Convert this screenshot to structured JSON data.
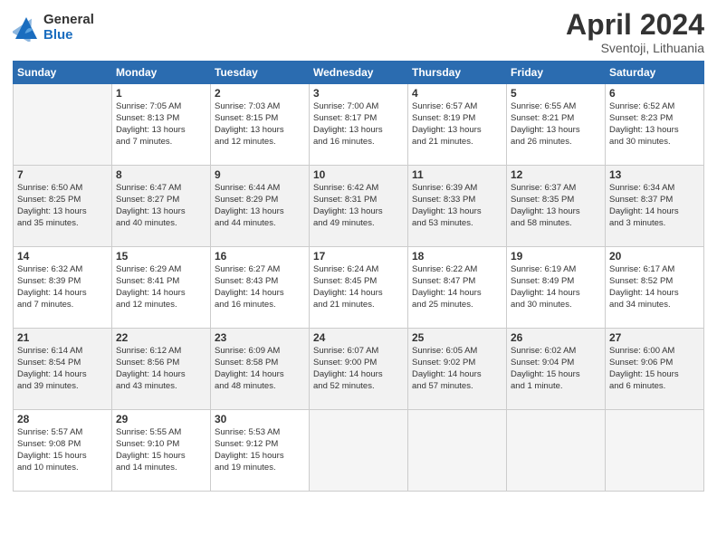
{
  "logo": {
    "general": "General",
    "blue": "Blue"
  },
  "title": "April 2024",
  "location": "Sventoji, Lithuania",
  "days_of_week": [
    "Sunday",
    "Monday",
    "Tuesday",
    "Wednesday",
    "Thursday",
    "Friday",
    "Saturday"
  ],
  "weeks": [
    [
      {
        "day": "",
        "info": ""
      },
      {
        "day": "1",
        "info": "Sunrise: 7:05 AM\nSunset: 8:13 PM\nDaylight: 13 hours\nand 7 minutes."
      },
      {
        "day": "2",
        "info": "Sunrise: 7:03 AM\nSunset: 8:15 PM\nDaylight: 13 hours\nand 12 minutes."
      },
      {
        "day": "3",
        "info": "Sunrise: 7:00 AM\nSunset: 8:17 PM\nDaylight: 13 hours\nand 16 minutes."
      },
      {
        "day": "4",
        "info": "Sunrise: 6:57 AM\nSunset: 8:19 PM\nDaylight: 13 hours\nand 21 minutes."
      },
      {
        "day": "5",
        "info": "Sunrise: 6:55 AM\nSunset: 8:21 PM\nDaylight: 13 hours\nand 26 minutes."
      },
      {
        "day": "6",
        "info": "Sunrise: 6:52 AM\nSunset: 8:23 PM\nDaylight: 13 hours\nand 30 minutes."
      }
    ],
    [
      {
        "day": "7",
        "info": "Sunrise: 6:50 AM\nSunset: 8:25 PM\nDaylight: 13 hours\nand 35 minutes."
      },
      {
        "day": "8",
        "info": "Sunrise: 6:47 AM\nSunset: 8:27 PM\nDaylight: 13 hours\nand 40 minutes."
      },
      {
        "day": "9",
        "info": "Sunrise: 6:44 AM\nSunset: 8:29 PM\nDaylight: 13 hours\nand 44 minutes."
      },
      {
        "day": "10",
        "info": "Sunrise: 6:42 AM\nSunset: 8:31 PM\nDaylight: 13 hours\nand 49 minutes."
      },
      {
        "day": "11",
        "info": "Sunrise: 6:39 AM\nSunset: 8:33 PM\nDaylight: 13 hours\nand 53 minutes."
      },
      {
        "day": "12",
        "info": "Sunrise: 6:37 AM\nSunset: 8:35 PM\nDaylight: 13 hours\nand 58 minutes."
      },
      {
        "day": "13",
        "info": "Sunrise: 6:34 AM\nSunset: 8:37 PM\nDaylight: 14 hours\nand 3 minutes."
      }
    ],
    [
      {
        "day": "14",
        "info": "Sunrise: 6:32 AM\nSunset: 8:39 PM\nDaylight: 14 hours\nand 7 minutes."
      },
      {
        "day": "15",
        "info": "Sunrise: 6:29 AM\nSunset: 8:41 PM\nDaylight: 14 hours\nand 12 minutes."
      },
      {
        "day": "16",
        "info": "Sunrise: 6:27 AM\nSunset: 8:43 PM\nDaylight: 14 hours\nand 16 minutes."
      },
      {
        "day": "17",
        "info": "Sunrise: 6:24 AM\nSunset: 8:45 PM\nDaylight: 14 hours\nand 21 minutes."
      },
      {
        "day": "18",
        "info": "Sunrise: 6:22 AM\nSunset: 8:47 PM\nDaylight: 14 hours\nand 25 minutes."
      },
      {
        "day": "19",
        "info": "Sunrise: 6:19 AM\nSunset: 8:49 PM\nDaylight: 14 hours\nand 30 minutes."
      },
      {
        "day": "20",
        "info": "Sunrise: 6:17 AM\nSunset: 8:52 PM\nDaylight: 14 hours\nand 34 minutes."
      }
    ],
    [
      {
        "day": "21",
        "info": "Sunrise: 6:14 AM\nSunset: 8:54 PM\nDaylight: 14 hours\nand 39 minutes."
      },
      {
        "day": "22",
        "info": "Sunrise: 6:12 AM\nSunset: 8:56 PM\nDaylight: 14 hours\nand 43 minutes."
      },
      {
        "day": "23",
        "info": "Sunrise: 6:09 AM\nSunset: 8:58 PM\nDaylight: 14 hours\nand 48 minutes."
      },
      {
        "day": "24",
        "info": "Sunrise: 6:07 AM\nSunset: 9:00 PM\nDaylight: 14 hours\nand 52 minutes."
      },
      {
        "day": "25",
        "info": "Sunrise: 6:05 AM\nSunset: 9:02 PM\nDaylight: 14 hours\nand 57 minutes."
      },
      {
        "day": "26",
        "info": "Sunrise: 6:02 AM\nSunset: 9:04 PM\nDaylight: 15 hours\nand 1 minute."
      },
      {
        "day": "27",
        "info": "Sunrise: 6:00 AM\nSunset: 9:06 PM\nDaylight: 15 hours\nand 6 minutes."
      }
    ],
    [
      {
        "day": "28",
        "info": "Sunrise: 5:57 AM\nSunset: 9:08 PM\nDaylight: 15 hours\nand 10 minutes."
      },
      {
        "day": "29",
        "info": "Sunrise: 5:55 AM\nSunset: 9:10 PM\nDaylight: 15 hours\nand 14 minutes."
      },
      {
        "day": "30",
        "info": "Sunrise: 5:53 AM\nSunset: 9:12 PM\nDaylight: 15 hours\nand 19 minutes."
      },
      {
        "day": "",
        "info": ""
      },
      {
        "day": "",
        "info": ""
      },
      {
        "day": "",
        "info": ""
      },
      {
        "day": "",
        "info": ""
      }
    ]
  ]
}
